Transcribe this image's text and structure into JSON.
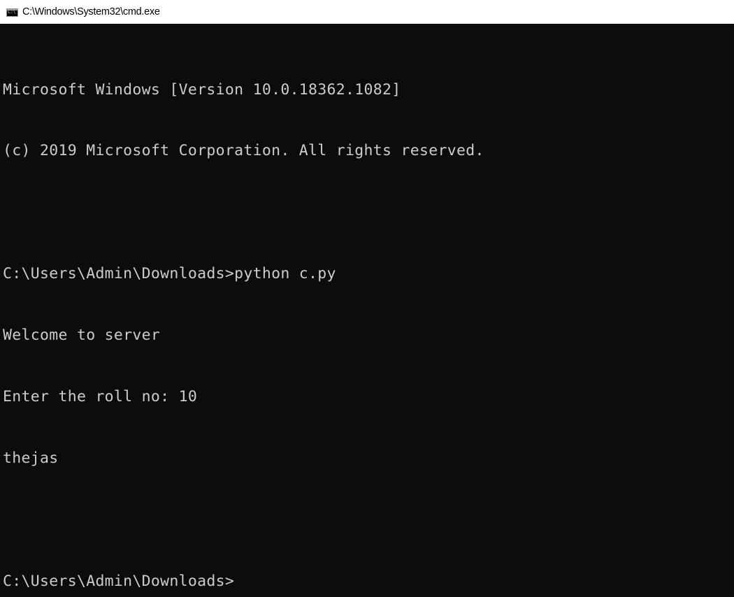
{
  "window": {
    "title": "C:\\Windows\\System32\\cmd.exe",
    "icon": "console-icon"
  },
  "console": {
    "lines": [
      "Microsoft Windows [Version 10.0.18362.1082]",
      "(c) 2019 Microsoft Corporation. All rights reserved.",
      "",
      "C:\\Users\\Admin\\Downloads>python c.py",
      "Welcome to server",
      "Enter the roll no: 10",
      "thejas",
      "",
      "C:\\Users\\Admin\\Downloads>"
    ]
  },
  "colors": {
    "background": "#0c0c0c",
    "text": "#cccccc",
    "titlebar": "#ffffff"
  }
}
